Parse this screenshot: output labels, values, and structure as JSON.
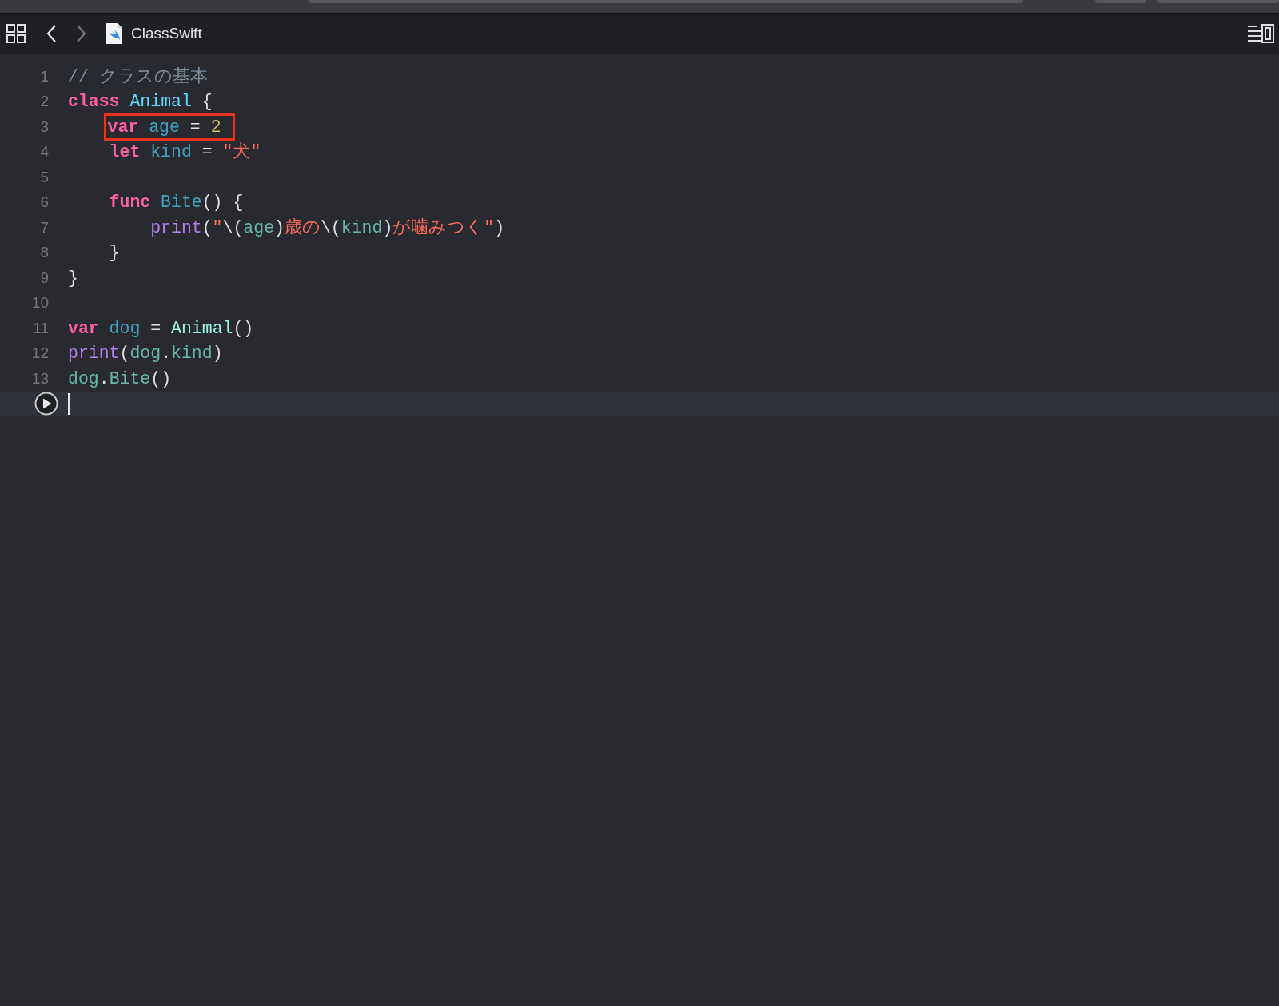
{
  "jump_bar": {
    "file_name": "ClassSwift"
  },
  "editor": {
    "lines": [
      {
        "number": "1",
        "boxed": false,
        "current": false,
        "tokens": [
          {
            "text": "// クラスの基本",
            "kind": "comment"
          }
        ]
      },
      {
        "number": "2",
        "boxed": false,
        "current": false,
        "tokens": [
          {
            "text": "class ",
            "kind": "keyword"
          },
          {
            "text": "Animal",
            "kind": "type_decl"
          },
          {
            "text": " {",
            "kind": "plain"
          }
        ]
      },
      {
        "number": "3",
        "boxed": true,
        "current": false,
        "tokens": [
          {
            "text": "var ",
            "kind": "keyword"
          },
          {
            "text": "age",
            "kind": "decl"
          },
          {
            "text": " = ",
            "kind": "plain"
          },
          {
            "text": "2",
            "kind": "number"
          }
        ]
      },
      {
        "number": "4",
        "boxed": false,
        "current": false,
        "tokens": [
          {
            "text": "let ",
            "kind": "keyword"
          },
          {
            "text": "kind",
            "kind": "decl"
          },
          {
            "text": " = ",
            "kind": "plain"
          },
          {
            "text": "\"犬\"",
            "kind": "string"
          }
        ]
      },
      {
        "number": "5",
        "current": false
      },
      {
        "number": "6",
        "boxed": false,
        "current": false,
        "tokens": [
          {
            "text": "func ",
            "kind": "keyword"
          },
          {
            "text": "Bite",
            "kind": "decl"
          },
          {
            "text": "() {",
            "kind": "plain"
          }
        ]
      },
      {
        "number": "7",
        "boxed": false,
        "current": false,
        "tokens": [
          {
            "text": "print",
            "kind": "builtin"
          },
          {
            "text": "(",
            "kind": "plain"
          },
          {
            "text": "\"",
            "kind": "string"
          },
          {
            "text": "\\(",
            "kind": "plain"
          },
          {
            "text": "age",
            "kind": "ref"
          },
          {
            "text": ")",
            "kind": "plain"
          },
          {
            "text": "歳の",
            "kind": "string"
          },
          {
            "text": "\\(",
            "kind": "plain"
          },
          {
            "text": "kind",
            "kind": "ref"
          },
          {
            "text": ")",
            "kind": "plain"
          },
          {
            "text": "が噛みつく\"",
            "kind": "string"
          },
          {
            "text": ")",
            "kind": "plain"
          }
        ]
      },
      {
        "number": "8",
        "boxed": false,
        "current": false,
        "tokens": [
          {
            "text": "}",
            "kind": "plain"
          }
        ]
      },
      {
        "number": "9",
        "boxed": false,
        "current": false,
        "tokens": [
          {
            "text": "}",
            "kind": "plain"
          }
        ]
      },
      {
        "number": "10",
        "current": false
      },
      {
        "number": "11",
        "boxed": false,
        "current": false,
        "tokens": [
          {
            "text": "var ",
            "kind": "keyword"
          },
          {
            "text": "dog",
            "kind": "decl"
          },
          {
            "text": " = ",
            "kind": "plain"
          },
          {
            "text": "Animal",
            "kind": "type_ref"
          },
          {
            "text": "()",
            "kind": "plain"
          }
        ]
      },
      {
        "number": "12",
        "boxed": false,
        "current": false,
        "tokens": [
          {
            "text": "print",
            "kind": "builtin"
          },
          {
            "text": "(",
            "kind": "plain"
          },
          {
            "text": "dog",
            "kind": "ref"
          },
          {
            "text": ".",
            "kind": "plain"
          },
          {
            "text": "kind",
            "kind": "ref"
          },
          {
            "text": ")",
            "kind": "plain"
          }
        ]
      },
      {
        "number": "13",
        "boxed": false,
        "current": false,
        "tokens": [
          {
            "text": "dog",
            "kind": "ref"
          },
          {
            "text": ".",
            "kind": "plain"
          },
          {
            "text": "Bite",
            "kind": "ref"
          },
          {
            "text": "()",
            "kind": "plain"
          }
        ]
      },
      {
        "current": true
      }
    ]
  }
}
